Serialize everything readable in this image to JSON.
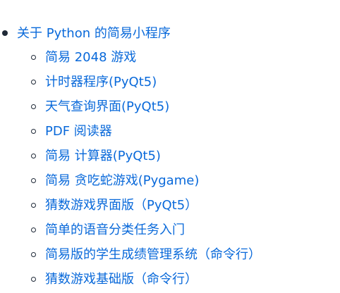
{
  "list": {
    "title": "关于 Python 的简易小程序",
    "items": [
      "简易 2048 游戏",
      "计时器程序(PyQt5)",
      "天气查询界面(PyQt5)",
      "PDF 阅读器",
      "简易 计算器(PyQt5)",
      "简易 贪吃蛇游戏(Pygame)",
      "猜数游戏界面版（PyQt5）",
      "简单的语音分类任务入门",
      "简易版的学生成绩管理系统（命令行）",
      "猜数游戏基础版（命令行）"
    ]
  },
  "colors": {
    "link": "#0969da",
    "bullet": "#1f2937",
    "background": "#ffffff"
  }
}
